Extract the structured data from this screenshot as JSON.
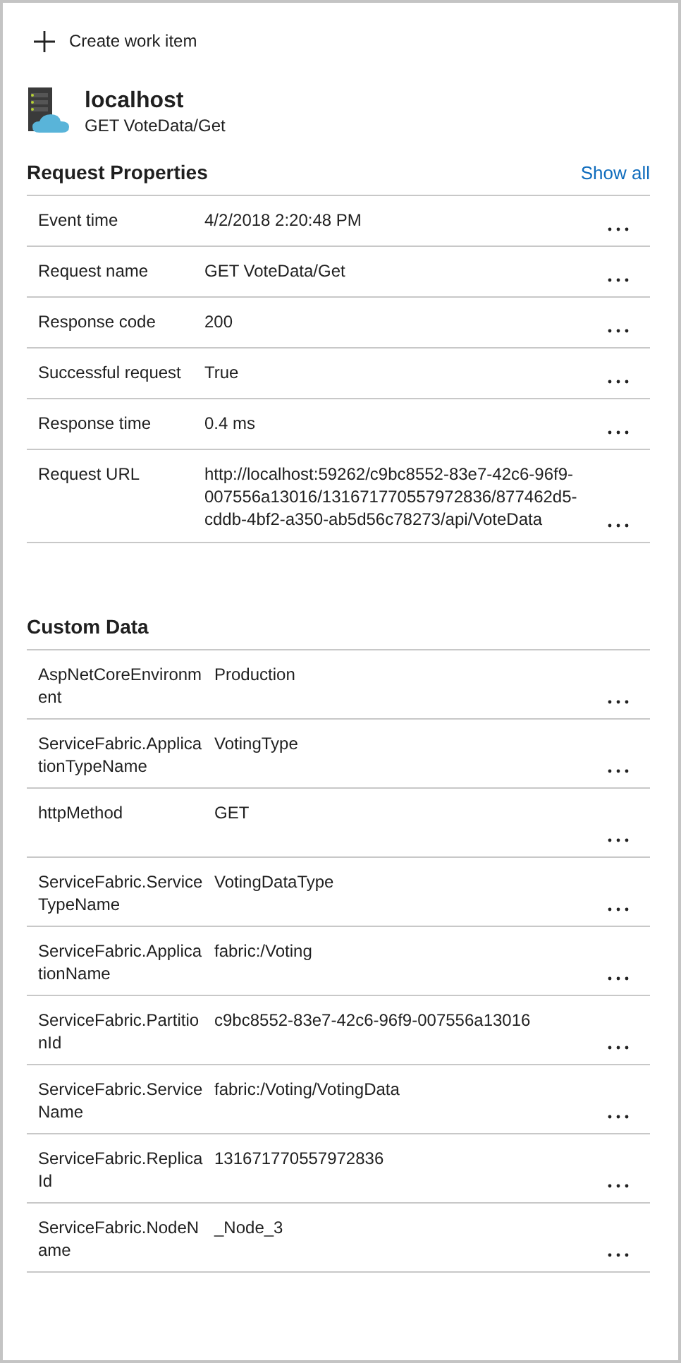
{
  "toolbar": {
    "create_label": "Create work item"
  },
  "header": {
    "title": "localhost",
    "subtitle": "GET VoteData/Get"
  },
  "sections": [
    {
      "title": "Request Properties",
      "link": "Show all",
      "kind": "request",
      "rows": [
        {
          "key": "Event time",
          "value": "4/2/2018 2:20:48 PM"
        },
        {
          "key": "Request name",
          "value": "GET VoteData/Get"
        },
        {
          "key": "Response code",
          "value": "200"
        },
        {
          "key": "Successful request",
          "value": "True"
        },
        {
          "key": "Response time",
          "value": "0.4 ms"
        },
        {
          "key": "Request URL",
          "value": "http://localhost:59262/c9bc8552-83e7-42c6-96f9-007556a13016/131671770557972836/877462d5-cddb-4bf2-a350-ab5d56c78273/api/VoteData"
        }
      ]
    },
    {
      "title": "Custom Data",
      "kind": "custom",
      "rows": [
        {
          "key": "AspNetCoreEnvironment",
          "value": "Production"
        },
        {
          "key": "ServiceFabric.ApplicationTypeName",
          "value": "VotingType"
        },
        {
          "key": "httpMethod",
          "value": "GET"
        },
        {
          "key": "ServiceFabric.ServiceTypeName",
          "value": "VotingDataType"
        },
        {
          "key": "ServiceFabric.ApplicationName",
          "value": "fabric:/Voting"
        },
        {
          "key": "ServiceFabric.PartitionId",
          "value": "c9bc8552-83e7-42c6-96f9-007556a13016"
        },
        {
          "key": "ServiceFabric.ServiceName",
          "value": "fabric:/Voting/VotingData"
        },
        {
          "key": "ServiceFabric.ReplicaId",
          "value": "131671770557972836"
        },
        {
          "key": "ServiceFabric.NodeName",
          "value": "_Node_3"
        }
      ]
    }
  ]
}
